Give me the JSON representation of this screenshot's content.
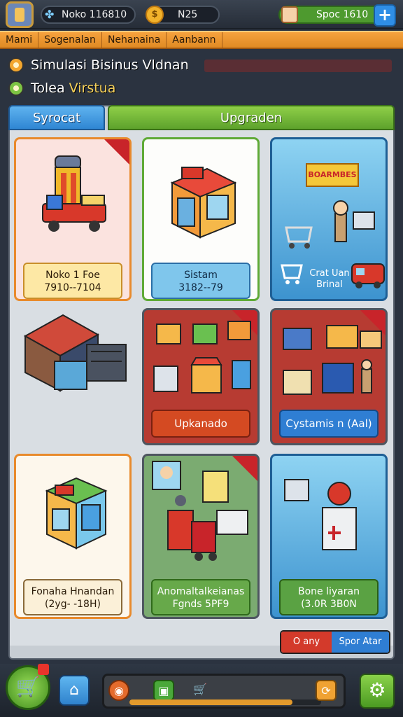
{
  "topbar": {
    "coins_text": "Noko 116810",
    "gems_text": "N25",
    "money_text": "Spoc 1610",
    "plus_label": "+"
  },
  "menu": {
    "items": [
      "Mami",
      "Sogenalan",
      "Nehanaina",
      "Aanbann"
    ]
  },
  "titles": {
    "line1": "Simulasi Bisinus Vldnan",
    "line2_main": "Tolea ",
    "line2_highlight": "Virstua"
  },
  "tabs": {
    "tab_a": "Syrocat",
    "tab_b": "Upgraden"
  },
  "cards": {
    "c1": {
      "line1": "Noko 1 Foe",
      "line2": "7910--7104"
    },
    "c2": {
      "line1": "Sistam",
      "line2": "3182--79"
    },
    "c3": {
      "caption1": "Crat Uan",
      "caption2": "Brinal",
      "sign": "BOARMBES"
    },
    "c5": {
      "button": "Upkanado"
    },
    "c6": {
      "button": "Cystamis n (Aal)"
    },
    "c7": {
      "line1": "Fonaha Hnandan",
      "line2": "(2yg- -18H)"
    },
    "c8": {
      "line1": "Anomaltalkeianas",
      "line2": "Fgnds 5PF9"
    },
    "c9": {
      "line1": "Bone liyaran",
      "line2": "(3.0R 3B0N"
    }
  },
  "split_button": {
    "left": "O any",
    "right": "Spor Atar"
  },
  "progress": {
    "fraction": 0.85
  },
  "colors": {
    "accent_orange": "#f6a23e",
    "accent_green": "#5da22c",
    "accent_blue": "#2f86d3",
    "danger_red": "#d33a2b"
  }
}
